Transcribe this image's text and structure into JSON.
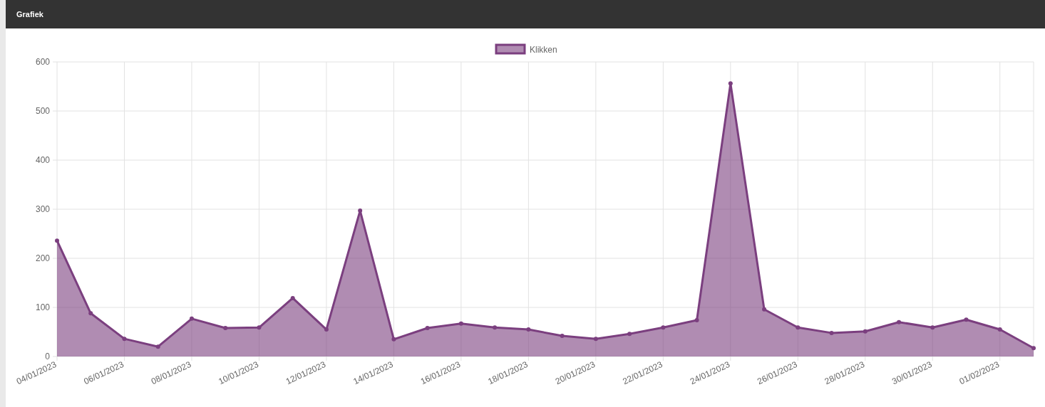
{
  "panel": {
    "title": "Grafiek"
  },
  "chart_data": {
    "type": "area",
    "categories": [
      "04/01/2023",
      null,
      "06/01/2023",
      null,
      "08/01/2023",
      null,
      "10/01/2023",
      null,
      "12/01/2023",
      null,
      "14/01/2023",
      null,
      "16/01/2023",
      null,
      "18/01/2023",
      null,
      "20/01/2023",
      null,
      "22/01/2023",
      null,
      "24/01/2023",
      null,
      "26/01/2023",
      null,
      "28/01/2023",
      null,
      "30/01/2023",
      null,
      "01/02/2023",
      null
    ],
    "ylim": [
      0,
      600
    ],
    "yticks": [
      0,
      100,
      200,
      300,
      400,
      500,
      600
    ],
    "grid": true,
    "series": [
      {
        "name": "Klikken",
        "color": "#7b3f7f",
        "values": [
          236,
          88,
          36,
          20,
          77,
          58,
          59,
          119,
          55,
          297,
          35,
          58,
          67,
          59,
          55,
          42,
          36,
          46,
          59,
          74,
          556,
          96,
          59,
          48,
          51,
          70,
          59,
          75,
          55,
          17
        ]
      }
    ]
  }
}
